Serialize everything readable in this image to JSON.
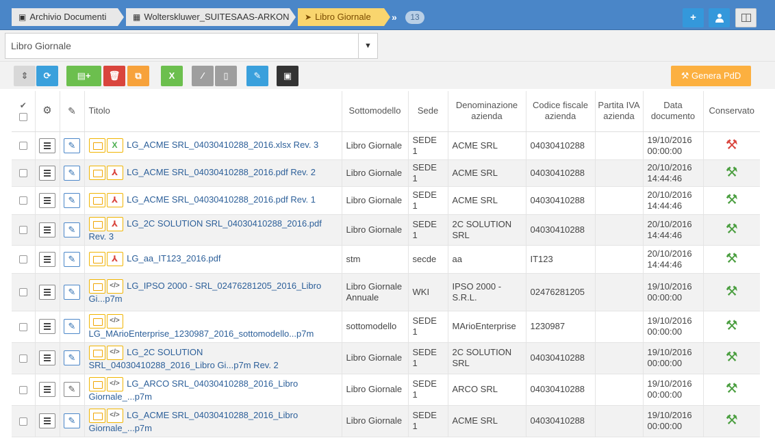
{
  "breadcrumb": {
    "items": [
      {
        "label": "Archivio Documenti"
      },
      {
        "label": "Wolterskluwer_SUITESAAS-ARKON"
      },
      {
        "label": "Libro Giornale"
      }
    ],
    "count": "13"
  },
  "header_buttons": {
    "add": "+",
    "user": "user",
    "layout": "layout"
  },
  "selector": {
    "value": "Libro Giornale"
  },
  "toolbar": {
    "genera_label": "Genera PdD",
    "colors": {
      "blue": "#3aa0dc",
      "green": "#6cbf4e",
      "red": "#d9453d",
      "orange": "#f7a23b",
      "gray": "#9e9e9e",
      "dark": "#333333",
      "genera": "#fcb040"
    }
  },
  "table": {
    "headers": {
      "titolo": "Titolo",
      "sottomodello": "Sottomodello",
      "sede": "Sede",
      "denominazione": "Denominazione azienda",
      "codice": "Codice fiscale azienda",
      "partita": "Partita IVA azienda",
      "data": "Data documento",
      "conservato": "Conservato"
    },
    "rows": [
      {
        "line1": "LG_ACME SRL_04030410288_2016.xlsx  Rev. 3",
        "line2": "",
        "sottomodello": "Libro Giornale",
        "sede": "SEDE 1",
        "denominazione": "ACME SRL",
        "codice": "04030410288",
        "partita": "",
        "data": "19/10/2016 00:00:00",
        "conservato": "red",
        "filetype": "xlsx"
      },
      {
        "line1": "LG_ACME SRL_04030410288_2016.pdf  Rev. 2",
        "line2": "",
        "sottomodello": "Libro Giornale",
        "sede": "SEDE 1",
        "denominazione": "ACME SRL",
        "codice": "04030410288",
        "partita": "",
        "data": "20/10/2016 14:44:46",
        "conservato": "green",
        "filetype": "pdf"
      },
      {
        "line1": "LG_ACME SRL_04030410288_2016.pdf  Rev. 1",
        "line2": "",
        "sottomodello": "Libro Giornale",
        "sede": "SEDE 1",
        "denominazione": "ACME SRL",
        "codice": "04030410288",
        "partita": "",
        "data": "20/10/2016 14:44:46",
        "conservato": "green",
        "filetype": "pdf"
      },
      {
        "line1": "LG_2C SOLUTION SRL_04030410288_2016.pdf",
        "line2": "Rev. 3",
        "sottomodello": "Libro Giornale",
        "sede": "SEDE 1",
        "denominazione": "2C SOLUTION SRL",
        "codice": "04030410288",
        "partita": "",
        "data": "20/10/2016 14:44:46",
        "conservato": "green",
        "filetype": "pdf"
      },
      {
        "line1": "LG_aa_IT123_2016.pdf",
        "line2": "",
        "sottomodello": "stm",
        "sede": "secde",
        "denominazione": "aa",
        "codice": "IT123",
        "partita": "",
        "data": "20/10/2016 14:44:46",
        "conservato": "green",
        "filetype": "pdf"
      },
      {
        "line1": "LG_IPSO 2000 - SRL_02476281205_2016_Libro",
        "line2": "Gi...p7m",
        "sottomodello": "Libro Giornale Annuale",
        "sede": "WKI",
        "denominazione": "IPSO 2000 - S.R.L.",
        "codice": "02476281205",
        "partita": "",
        "data": "19/10/2016 00:00:00",
        "conservato": "green",
        "filetype": "p7m"
      },
      {
        "line1": "",
        "line2": "LG_MArioEnterprise_1230987_2016_sottomodello...p7m",
        "sottomodello": "sottomodello",
        "sede": "SEDE 1",
        "denominazione": "MArioEnterprise",
        "codice": "1230987",
        "partita": "",
        "data": "19/10/2016 00:00:00",
        "conservato": "green",
        "filetype": "p7m"
      },
      {
        "line1": "LG_2C SOLUTION",
        "line2": "SRL_04030410288_2016_Libro Gi...p7m  Rev. 2",
        "sottomodello": "Libro Giornale",
        "sede": "SEDE 1",
        "denominazione": "2C SOLUTION SRL",
        "codice": "04030410288",
        "partita": "",
        "data": "19/10/2016 00:00:00",
        "conservato": "green",
        "filetype": "p7m"
      },
      {
        "line1": "LG_ARCO SRL_04030410288_2016_Libro",
        "line2": "Giornale_...p7m",
        "sottomodello": "Libro Giornale",
        "sede": "SEDE 1",
        "denominazione": "ARCO SRL",
        "codice": "04030410288",
        "partita": "",
        "data": "19/10/2016 00:00:00",
        "conservato": "green",
        "filetype": "p7m"
      },
      {
        "line1": "LG_ACME SRL_04030410288_2016_Libro",
        "line2": "Giornale_...p7m",
        "sottomodello": "Libro Giornale",
        "sede": "SEDE 1",
        "denominazione": "ACME SRL",
        "codice": "04030410288",
        "partita": "",
        "data": "19/10/2016 00:00:00",
        "conservato": "green",
        "filetype": "p7m"
      }
    ]
  }
}
